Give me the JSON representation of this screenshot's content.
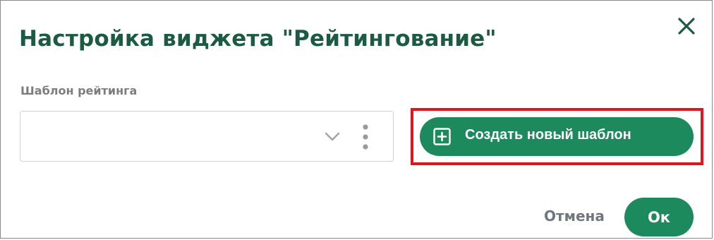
{
  "dialog": {
    "title": "Настройка виджета \"Рейтингование\"",
    "close_icon": "close-icon"
  },
  "template_field": {
    "label": "Шаблон рейтинга",
    "value": "",
    "dropdown_icon": "chevron-down-icon",
    "more_icon": "vertical-dots-icon"
  },
  "create_button": {
    "label": "Создать новый шаблон",
    "icon": "plus-square-icon"
  },
  "footer": {
    "cancel_label": "Отмена",
    "ok_label": "Ок"
  },
  "colors": {
    "title": "#1d5a43",
    "primary": "#1c8a5c",
    "highlight": "#e3141e",
    "muted_text": "#7d7d7d"
  }
}
